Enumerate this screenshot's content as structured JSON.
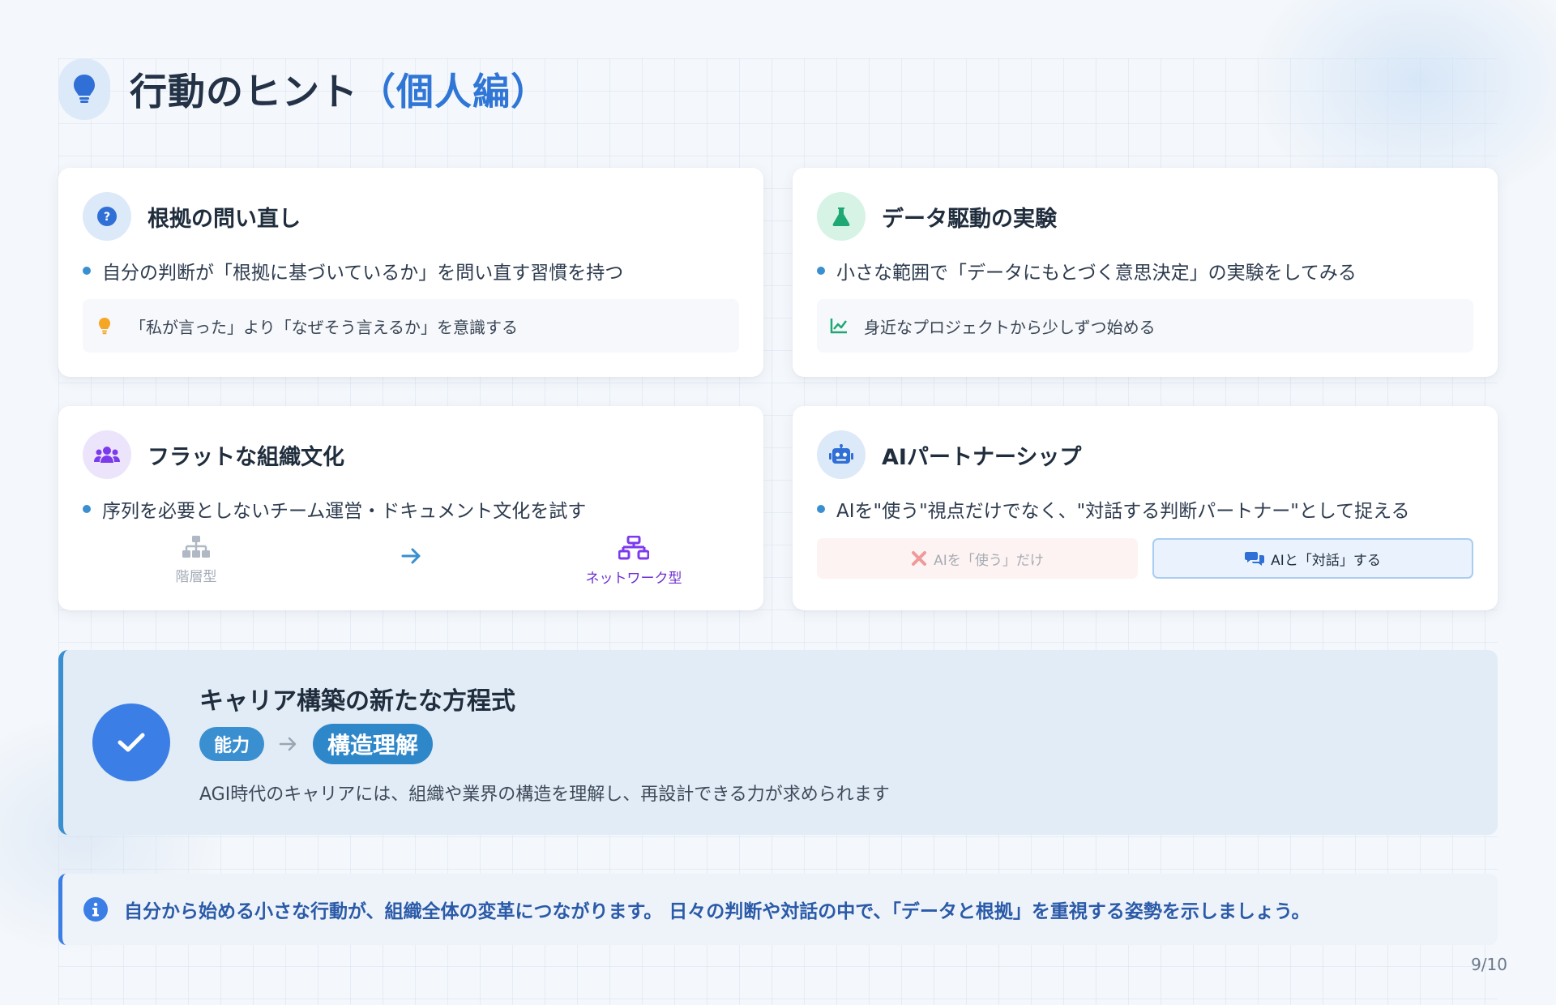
{
  "header": {
    "title_main": "行動のヒント",
    "title_accent": "（個人編）",
    "icon": "lightbulb-icon"
  },
  "cards": [
    {
      "title": "根拠の問い直し",
      "icon": "question-circle-icon",
      "bullet": "自分の判断が「根拠に基づいているか」を問い直す習慣を持つ",
      "note": "「私が言った」より「なぜそう言えるか」を意識する",
      "note_icon": "lightbulb-icon"
    },
    {
      "title": "データ駆動の実験",
      "icon": "flask-icon",
      "bullet": "小さな範囲で「データにもとづく意思決定」の実験をしてみる",
      "note": "身近なプロジェクトから少しずつ始める",
      "note_icon": "line-chart-icon"
    },
    {
      "title": "フラットな組織文化",
      "icon": "users-icon",
      "bullet": "序列を必要としないチーム運営・ドキュメント文化を試す",
      "flow_from": "階層型",
      "flow_to": "ネットワーク型"
    },
    {
      "title": "AIパートナーシップ",
      "icon": "robot-icon",
      "bullet": "AIを\"使う\"視点だけでなく、\"対話する判断パートナー\"として捉える",
      "option_use": "AIを「使う」だけ",
      "option_dialog": "AIと「対話」する"
    }
  ],
  "equation": {
    "title": "キャリア構築の新たな方程式",
    "from": "能力",
    "to": "構造理解",
    "description": "AGI時代のキャリアには、組織や業界の構造を理解し、再設計できる力が求められます"
  },
  "info": {
    "text": "自分から始める小さな行動が、組織全体の変革につながります。 日々の判断や対話の中で、「データと根拠」を重視する姿勢を示しましょう。"
  },
  "page_number": "9/10",
  "colors": {
    "accent_blue": "#2f76d6",
    "bullet_blue": "#3a8fd0",
    "green": "#1fa873",
    "purple": "#7c3aed",
    "amber": "#f5a623"
  }
}
